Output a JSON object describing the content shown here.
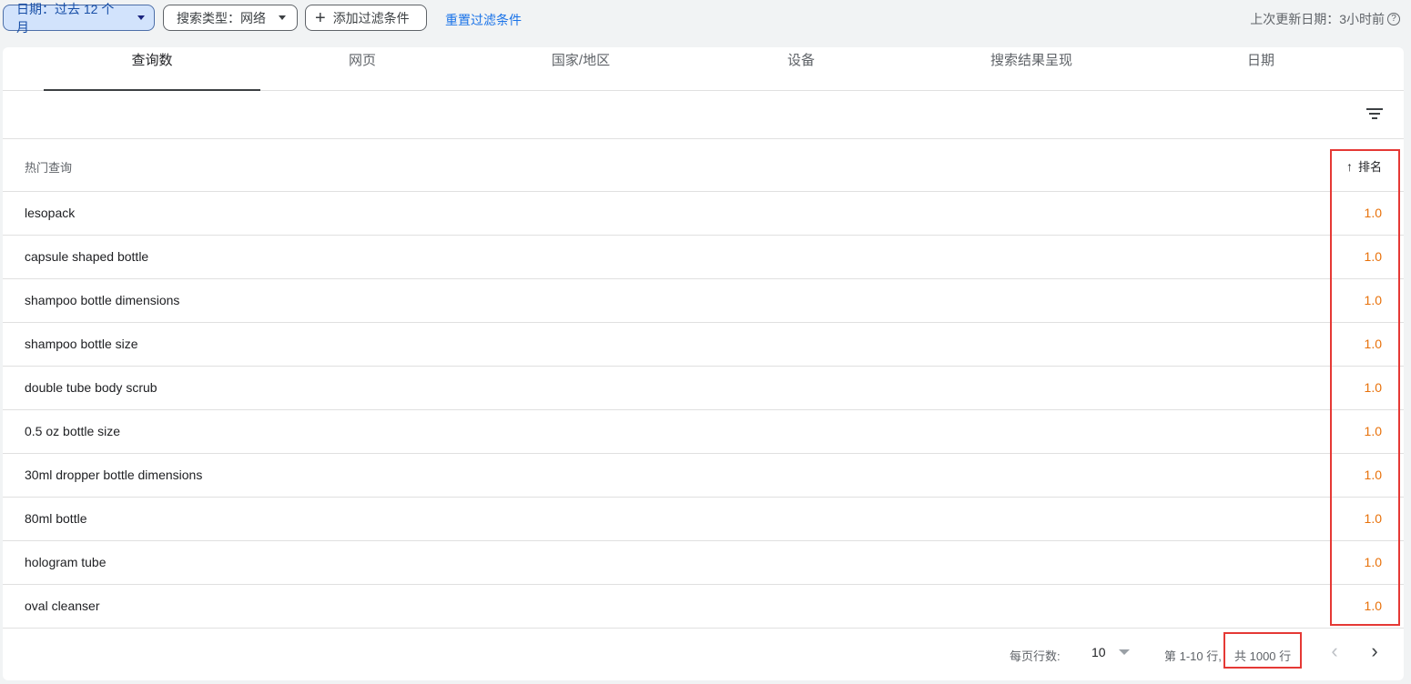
{
  "filters": {
    "date_chip": "日期：过去 12 个月",
    "search_type_chip": "搜索类型：网络",
    "add_filter": "添加过滤条件",
    "reset": "重置过滤条件",
    "last_updated": "上次更新日期：3小时前"
  },
  "tabs": [
    "查询数",
    "网页",
    "国家/地区",
    "设备",
    "搜索结果呈现",
    "日期"
  ],
  "table": {
    "query_header": "热门查询",
    "rank_header": "排名",
    "rows": [
      {
        "query": "lesopack",
        "rank": "1.0"
      },
      {
        "query": "capsule shaped bottle",
        "rank": "1.0"
      },
      {
        "query": "shampoo bottle dimensions",
        "rank": "1.0"
      },
      {
        "query": "shampoo bottle size",
        "rank": "1.0"
      },
      {
        "query": "double tube body scrub",
        "rank": "1.0"
      },
      {
        "query": "0.5 oz bottle size",
        "rank": "1.0"
      },
      {
        "query": "30ml dropper bottle dimensions",
        "rank": "1.0"
      },
      {
        "query": "80ml bottle",
        "rank": "1.0"
      },
      {
        "query": "hologram tube",
        "rank": "1.0"
      },
      {
        "query": "oval cleanser",
        "rank": "1.0"
      }
    ]
  },
  "pagination": {
    "rows_per_page_label": "每页行数:",
    "rows_per_page": "10",
    "range": "第 1-10 行,",
    "total": "共 1000 行"
  },
  "icons": {
    "help": "help-icon",
    "filter": "filter-list-icon",
    "sort": "arrow-up-icon",
    "prev": "chevron-left-icon",
    "next": "chevron-right-icon"
  },
  "colors": {
    "accent": "#1a73e8",
    "rank_value": "#e8710a",
    "highlight": "#e53935"
  }
}
